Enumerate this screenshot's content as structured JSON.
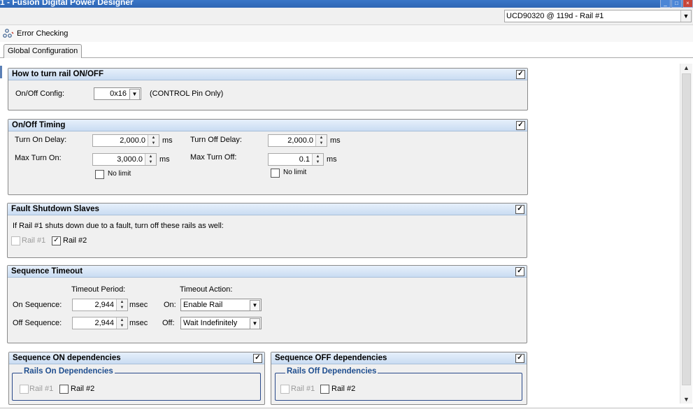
{
  "window": {
    "title": "1 - Fusion Digital Power Designer"
  },
  "device_selector": {
    "value": "UCD90320 @ 119d - Rail #1"
  },
  "toolbar": {
    "error_checking": "Error Checking"
  },
  "tabs": [
    {
      "label": "Global Configuration"
    }
  ],
  "panels": {
    "onoff": {
      "title": "How to turn rail ON/OFF",
      "config_label": "On/Off Config:",
      "config_value": "0x16",
      "config_desc": "(CONTROL Pin Only)"
    },
    "timing": {
      "title": "On/Off Timing",
      "turn_on_delay_label": "Turn On Delay:",
      "turn_on_delay": "2,000.0",
      "turn_off_delay_label": "Turn Off Delay:",
      "turn_off_delay": "2,000.0",
      "max_turn_on_label": "Max Turn On:",
      "max_turn_on": "3,000.0",
      "max_turn_off_label": "Max Turn Off:",
      "max_turn_off": "0.1",
      "unit": "ms",
      "no_limit": "No limit"
    },
    "fault": {
      "title": "Fault Shutdown Slaves",
      "desc": "If Rail #1 shuts down due to a fault, turn off these rails as well:",
      "rail1": "Rail #1",
      "rail2": "Rail #2"
    },
    "timeout": {
      "title": "Sequence Timeout",
      "period_header": "Timeout Period:",
      "action_header": "Timeout Action:",
      "on_seq_label": "On Sequence:",
      "on_seq_value": "2,944",
      "off_seq_label": "Off Sequence:",
      "off_seq_value": "2,944",
      "unit": "msec",
      "on_label": "On:",
      "on_action": "Enable Rail",
      "off_label": "Off:",
      "off_action": "Wait Indefinitely"
    },
    "seq_on": {
      "title": "Sequence ON dependencies",
      "group": "Rails On Dependencies",
      "rail1": "Rail #1",
      "rail2": "Rail #2"
    },
    "seq_off": {
      "title": "Sequence OFF dependencies",
      "group": "Rails Off Dependencies",
      "rail1": "Rail #1",
      "rail2": "Rail #2"
    }
  },
  "checks": {
    "checked": "✓"
  }
}
